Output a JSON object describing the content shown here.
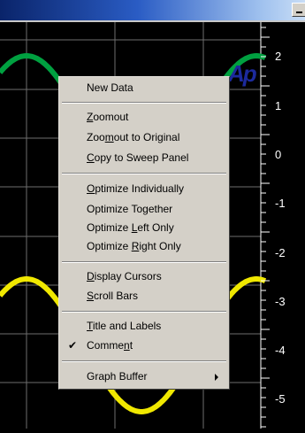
{
  "logo_text": "Ap",
  "y_axis_labels": [
    "2",
    "1",
    "0",
    "-1",
    "-2",
    "-3",
    "-4",
    "-5"
  ],
  "colors": {
    "background": "#000000",
    "grid": "#6e6e6e",
    "trace_left": "#00a040",
    "trace_right": "#f0e800",
    "menu_bg": "#d4d0c8"
  },
  "menu": {
    "new_data": {
      "pre": "New Data",
      "key": "",
      "post": ""
    },
    "zoomout": {
      "pre": "",
      "key": "Z",
      "post": "oomout"
    },
    "zoomout_original": {
      "pre": "Zoo",
      "key": "m",
      "post": "out to Original"
    },
    "copy_sweep": {
      "pre": "",
      "key": "C",
      "post": "opy to Sweep Panel"
    },
    "opt_individually": {
      "pre": "",
      "key": "O",
      "post": "ptimize Individually"
    },
    "opt_together": {
      "pre": "Optimize To",
      "key": "g",
      "post": "ether"
    },
    "opt_left": {
      "pre": "Optimize ",
      "key": "L",
      "post": "eft Only"
    },
    "opt_right": {
      "pre": "Optimize ",
      "key": "R",
      "post": "ight Only"
    },
    "display_cursors": {
      "pre": "",
      "key": "D",
      "post": "isplay Cursors"
    },
    "scroll_bars": {
      "pre": "",
      "key": "S",
      "post": "croll Bars"
    },
    "title_labels": {
      "pre": "",
      "key": "T",
      "post": "itle and Labels"
    },
    "comment": {
      "pre": "Comme",
      "key": "n",
      "post": "t",
      "checked": true
    },
    "graph_buffer": {
      "pre": "Graph Buffer",
      "key": "",
      "post": "",
      "submenu": true
    }
  }
}
